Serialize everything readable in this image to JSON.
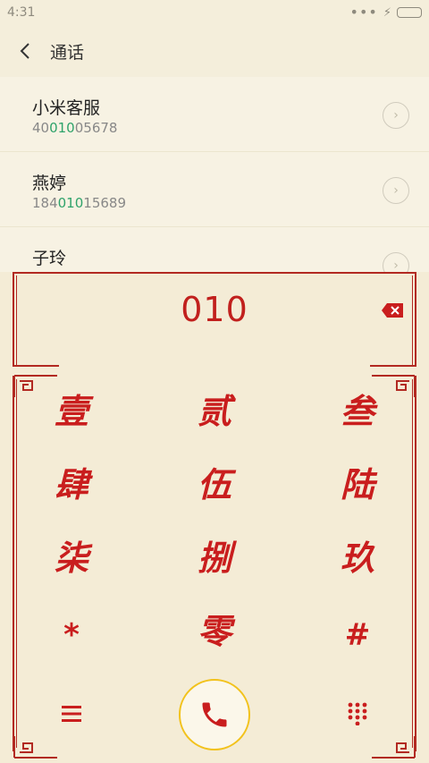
{
  "status": {
    "time": "4:31"
  },
  "header": {
    "title": "通话"
  },
  "results": [
    {
      "name": "小米客服",
      "number_prefix": "40",
      "number_match": "010",
      "number_suffix": "05678"
    },
    {
      "name": "燕婷",
      "number_prefix": "184",
      "number_match": "010",
      "number_suffix": "15689"
    },
    {
      "name": "子玲",
      "number_prefix": "",
      "number_match": "",
      "number_suffix": ""
    }
  ],
  "dialer": {
    "input": "010",
    "keys": [
      "壹",
      "贰",
      "叁",
      "肆",
      "伍",
      "陆",
      "柒",
      "捌",
      "玖",
      "*",
      "零",
      "#"
    ]
  },
  "colors": {
    "accent_red": "#c91e1e",
    "match_green": "#2fa36b",
    "call_ring": "#f2c21c",
    "background": "#f4eedb"
  },
  "icons": {
    "back": "chevron-left-icon",
    "backspace": "backspace-icon",
    "call": "phone-icon",
    "menu": "menu-icon",
    "keypad": "keypad-icon"
  }
}
